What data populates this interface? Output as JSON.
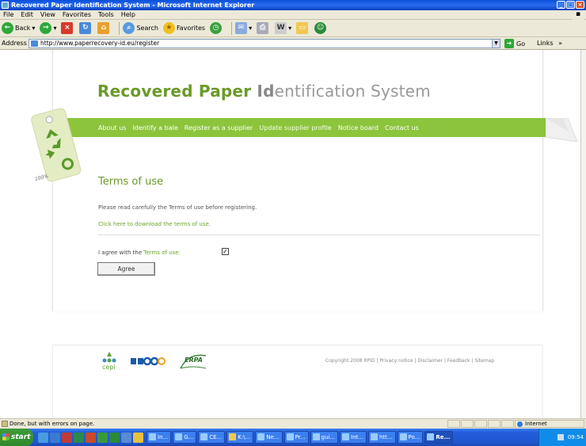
{
  "window": {
    "title": "Recovered Paper Identification System - Microsoft Internet Explorer"
  },
  "menu": [
    "File",
    "Edit",
    "View",
    "Favorites",
    "Tools",
    "Help"
  ],
  "toolbar": {
    "back": "Back",
    "search": "Search",
    "favorites": "Favorites"
  },
  "address": {
    "label": "Address",
    "url": "http://www.paperrecovery-id.eu/register",
    "go": "Go",
    "links": "Links"
  },
  "site": {
    "title_parts": [
      {
        "text": "R",
        "style": "b"
      },
      {
        "text": "ecovered ",
        "style": "n"
      },
      {
        "text": "P",
        "style": "b"
      },
      {
        "text": "aper ",
        "style": "n"
      },
      {
        "text": "Id",
        "style": "g"
      },
      {
        "text": "entification System",
        "style": "n"
      }
    ],
    "nav": [
      "About us",
      "Identify a bale",
      "Register as a supplier",
      "Update supplier profile",
      "Notice board",
      "Contact us"
    ],
    "tag_text": "100%"
  },
  "content": {
    "heading": "Terms of use",
    "instruction": "Please read carefully the Terms of use before registering.",
    "download_link": "Click here to download the terms of use.",
    "agree_prefix": "I agree with the ",
    "agree_link": "Terms of use:",
    "checkbox_checked": true,
    "agree_button": "Agree"
  },
  "footer": {
    "copyright": "Copyright 2008 RPID | Privacy notice | Disclaimer | Feedback | Sitemap",
    "logo_cepi": "cepi",
    "logo_erpa": "ERPA"
  },
  "status": {
    "text": "Done, but with errors on page.",
    "zone": "Internet"
  },
  "taskbar": {
    "start": "start",
    "tasks": [
      "In...",
      "G...",
      "CE...",
      "K:\\...",
      "Ne...",
      "Pr...",
      "gui...",
      "Int...",
      "htt...",
      "Po...",
      "Re..."
    ],
    "clock": "09:54"
  },
  "colors": {
    "accent": "#8cc43c",
    "title_green": "#6a9a28",
    "link": "#6ca428"
  }
}
